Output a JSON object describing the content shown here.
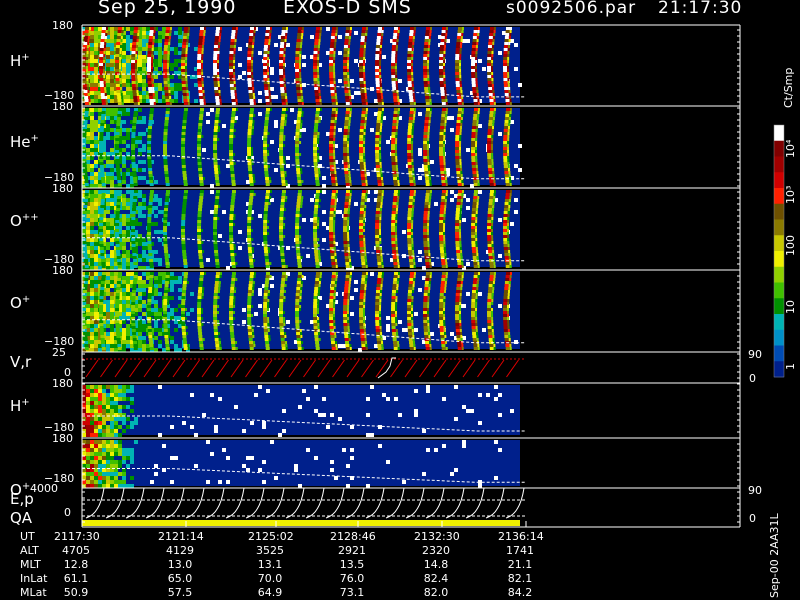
{
  "header": {
    "date": "Sep 25, 1990",
    "mission": "EXOS-D SMS",
    "file": "s0092506.par",
    "time": "21:17:30"
  },
  "panels": [
    {
      "id": "h-plus",
      "label": "H",
      "charge": "+",
      "top": "180",
      "bottom": "−180"
    },
    {
      "id": "he-plus",
      "label": "He",
      "charge": "+",
      "top": "180",
      "bottom": "−180"
    },
    {
      "id": "o-pp",
      "label": "O",
      "charge": "++",
      "top": "180",
      "bottom": "−180"
    },
    {
      "id": "o-plus",
      "label": "O",
      "charge": "+",
      "top": "180",
      "bottom": "−180"
    },
    {
      "id": "vr",
      "label": "V,r",
      "charge": "",
      "top": "25",
      "bottom": "0",
      "right_top": "90",
      "right_bottom": "0"
    },
    {
      "id": "h-plus-2",
      "label": "H",
      "charge": "+",
      "top": "180",
      "bottom": "−180"
    },
    {
      "id": "o-plus-2",
      "label": "O",
      "charge": "+",
      "top": "180",
      "bottom": "−180"
    },
    {
      "id": "ep",
      "label": "E,p",
      "charge": "",
      "top": "4000",
      "bottom": "0",
      "right_top": "90",
      "right_bottom": "0"
    }
  ],
  "qa_label": "QA",
  "colorbar": {
    "unit": "Ct/Smp",
    "ticks": [
      "10⁴",
      "10³",
      "100",
      "10",
      "1"
    ],
    "colors": [
      "#ffffff",
      "#800000",
      "#a00000",
      "#d00000",
      "#ff2000",
      "#6e5000",
      "#8a7a00",
      "#c8c800",
      "#f0f000",
      "#90d000",
      "#40c000",
      "#009000",
      "#00b4b4",
      "#0090c8",
      "#004cb4",
      "#00208c"
    ]
  },
  "footer_id": "Sep-00 2AA31L",
  "ephemeris": {
    "rows": [
      {
        "name": "UT",
        "values": [
          "2117:30",
          "2121:14",
          "2125:02",
          "2128:46",
          "2132:30",
          "2136:14"
        ]
      },
      {
        "name": "ALT",
        "values": [
          "4705",
          "4129",
          "3525",
          "2921",
          "2320",
          "1741"
        ]
      },
      {
        "name": "MLT",
        "values": [
          "12.8",
          "13.0",
          "13.1",
          "13.5",
          "14.8",
          "21.1"
        ]
      },
      {
        "name": "InLat",
        "values": [
          "61.1",
          "65.0",
          "70.0",
          "76.0",
          "82.4",
          "82.1"
        ]
      },
      {
        "name": "MLat",
        "values": [
          "50.9",
          "57.5",
          "64.9",
          "73.1",
          "82.0",
          "84.2"
        ]
      }
    ]
  },
  "chart_data": {
    "type": "heatmap",
    "title": "Sep 25, 1990   EXOS-D SMS",
    "x": [
      "2117:30",
      "2121:14",
      "2125:02",
      "2128:46",
      "2132:30",
      "2136:14"
    ],
    "xlabel": "UT",
    "colorbar_label": "Ct/Smp",
    "colorbar_range": [
      1,
      10000
    ],
    "colorbar_scale": "log",
    "series": [
      {
        "name": "H+",
        "ylim": [
          -180,
          180
        ]
      },
      {
        "name": "He+",
        "ylim": [
          -180,
          180
        ]
      },
      {
        "name": "O++",
        "ylim": [
          -180,
          180
        ]
      },
      {
        "name": "O+",
        "ylim": [
          -180,
          180
        ]
      },
      {
        "name": "V,r",
        "ylim": [
          0,
          25
        ],
        "right_ylim": [
          0,
          90
        ]
      },
      {
        "name": "H+",
        "ylim": [
          -180,
          180
        ]
      },
      {
        "name": "O+",
        "ylim": [
          -180,
          180
        ]
      },
      {
        "name": "E,p",
        "ylim": [
          0,
          4000
        ],
        "right_ylim": [
          0,
          90
        ]
      }
    ]
  }
}
